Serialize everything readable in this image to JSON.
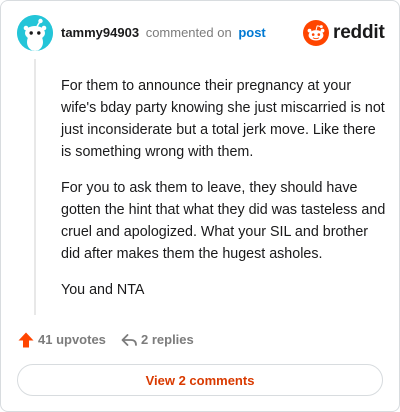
{
  "header": {
    "username": "tammy94903",
    "action_text": "commented on",
    "target_text": "post",
    "logo_text": "reddit",
    "avatar_icon": "snoo-avatar-icon",
    "logo_icon": "reddit-alien-icon"
  },
  "comment": {
    "paragraphs": [
      "For them to announce their pregnancy at your wife's bday party knowing she just miscarried is not just inconsiderate but a total jerk move. Like there is something wrong with them.",
      "For you to ask them to leave, they should have gotten the hint that what they did was tasteless and cruel and apologized. What your SIL and brother did after makes them the hugest asholes.",
      "You and NTA"
    ]
  },
  "actions": {
    "upvotes_label": "41 upvotes",
    "replies_label": "2 replies",
    "upvote_icon": "upvote-arrow-icon",
    "reply_icon": "reply-arrow-icon"
  },
  "footer": {
    "view_button_label": "View 2 comments"
  },
  "colors": {
    "accent_orange": "#ff4500",
    "link_blue": "#0079d3",
    "button_text": "#d93a00",
    "avatar_bg": "#24c5d8"
  }
}
